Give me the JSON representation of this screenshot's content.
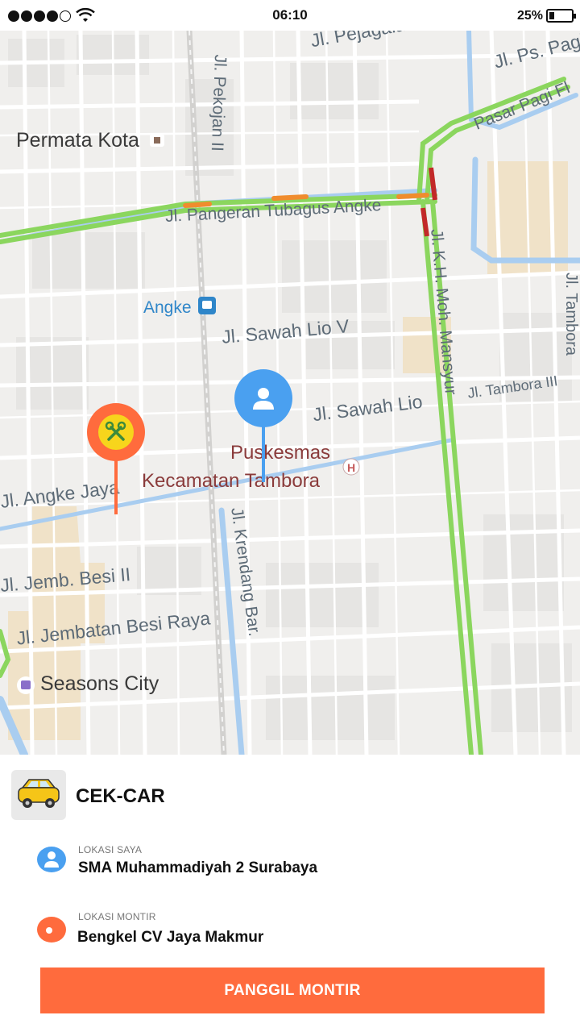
{
  "status_bar": {
    "time": "06:10",
    "battery": "25%",
    "signal_bars_filled": 4,
    "signal_bars_total": 5
  },
  "map": {
    "labels": {
      "permata_kota": "Permata Kota",
      "pejagalan": "Jl. Pejagalan",
      "pekojan": "Jl. Pekojan II",
      "ps_pagi": "Jl. Ps. Pagi",
      "pasar_pagi": "Pasar Pagi Fl",
      "tubagus": "Jl. Pangeran Tubagus Angke",
      "angke": "Angke",
      "sawah_lio_v": "Jl. Sawah Lio V",
      "sawah_lio": "Jl. Sawah Lio",
      "tambora_iii": "Jl. Tambora III",
      "tambora": "Jl. Tambora",
      "mansyur": "Jl. K.H. Moh. Mansyur",
      "puskesmas_1": "Puskesmas",
      "puskesmas_2": "Kecamatan Tambora",
      "angke_jaya": "Jl. Angke Jaya",
      "jemb_besi_ii": "Jl. Jemb. Besi II",
      "jembatan_besi_raya": "Jl. Jembatan Besi Raya",
      "krendang": "Jl. Krendang Bar.",
      "seasons_city": "Seasons City"
    },
    "user_pin_icon": "user-icon",
    "mechanic_pin_icon": "tools-icon"
  },
  "sheet": {
    "app_name": "CEK-CAR",
    "app_icon": "car-icon",
    "my_location": {
      "caption": "LOKASI SAYA",
      "value": "SMA Muhammadiyah 2 Surabaya"
    },
    "mechanic_location": {
      "caption": "LOKASI MONTIR",
      "value": "Bengkel CV Jaya Makmur"
    },
    "call_button": "PANGGIL MONTIR"
  },
  "colors": {
    "accent": "#ff6b3d",
    "user_blue": "#4aa0f0",
    "road_green": "#8bd65e",
    "water": "#a9cdf0"
  }
}
